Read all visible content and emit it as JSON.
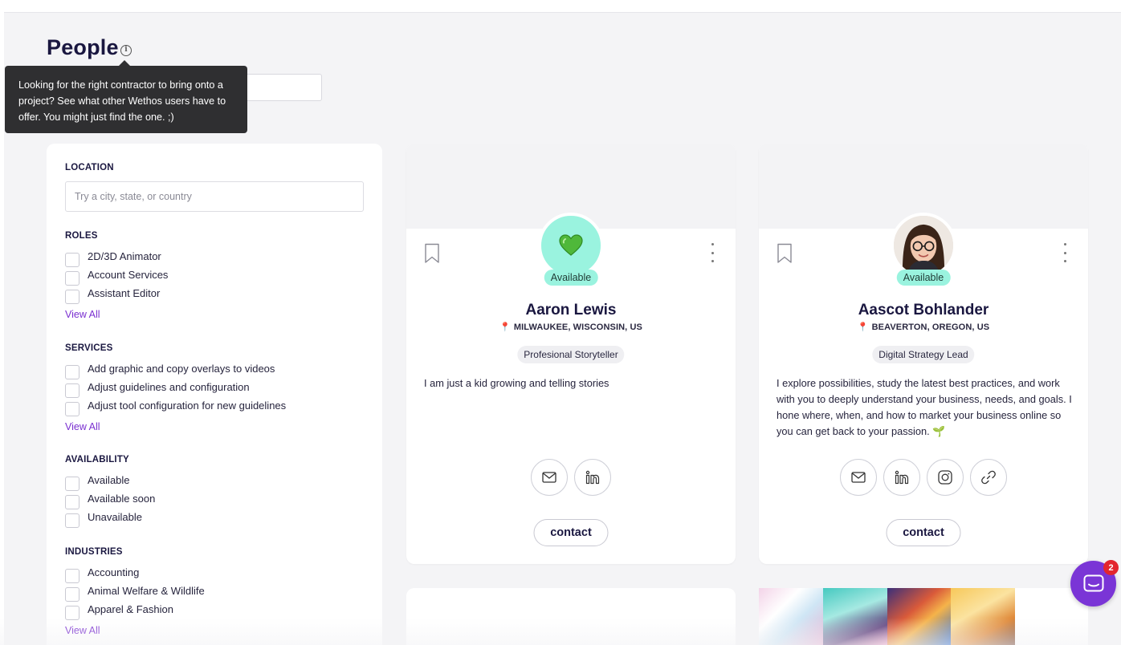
{
  "page": {
    "title": "People"
  },
  "tooltip": {
    "text": "Looking for the right contractor to bring onto a project? See what other Wethos users have to offer. You might just find the one. ;)"
  },
  "filters": {
    "location": {
      "heading": "LOCATION",
      "placeholder": "Try a city, state, or country"
    },
    "roles": {
      "heading": "ROLES",
      "options": [
        "2D/3D Animator",
        "Account Services",
        "Assistant Editor"
      ],
      "view_all": "View All"
    },
    "services": {
      "heading": "SERVICES",
      "options": [
        "Add graphic and copy overlays to videos",
        "Adjust guidelines and configuration",
        "Adjust tool configuration for new guidelines"
      ],
      "view_all": "View All"
    },
    "availability": {
      "heading": "AVAILABILITY",
      "options": [
        "Available",
        "Available soon",
        "Unavailable"
      ]
    },
    "industries": {
      "heading": "INDUSTRIES",
      "options": [
        "Accounting",
        "Animal Welfare & Wildlife",
        "Apparel & Fashion"
      ],
      "view_all": "View All"
    }
  },
  "cards": [
    {
      "status": "Available",
      "name": "Aaron Lewis",
      "location": "MILWAUKEE, WISCONSIN, US",
      "role": "Profesional Storyteller",
      "bio": "I am just a kid growing and telling stories",
      "socials": [
        "mail-icon",
        "linkedin-icon"
      ],
      "contact": "contact",
      "avatar": "green-heart-icon"
    },
    {
      "status": "Available",
      "name": "Aascot Bohlander",
      "location": "BEAVERTON, OREGON, US",
      "role": "Digital Strategy Lead",
      "bio": "I explore possibilities, study the latest best practices, and work with you to deeply understand your business, needs, and goals. I hone where, when, and how to market your business online so you can get back to your passion. 🌱",
      "socials": [
        "mail-icon",
        "linkedin-icon",
        "instagram-icon",
        "link-icon"
      ],
      "contact": "contact",
      "avatar": "photo"
    }
  ],
  "chat": {
    "badge": "2"
  },
  "colors": {
    "accent": "#7a35d6",
    "available": "#9af3df",
    "link": "#7a2fd0"
  }
}
